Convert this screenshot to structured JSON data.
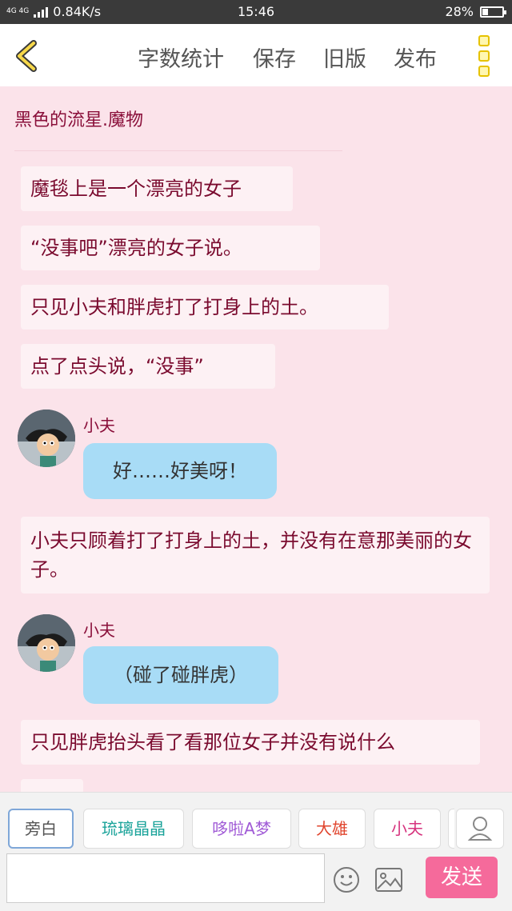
{
  "status_bar": {
    "network": "4G 4G",
    "speed": "0.84K/s",
    "time": "15:46",
    "battery": "28%",
    "battery_level": 0.28
  },
  "toolbar": {
    "back_icon": "chevron-left-icon",
    "word_count": "字数统计",
    "save": "保存",
    "old_version": "旧版",
    "publish": "发布",
    "more_icon": "more-vertical-icon"
  },
  "story": {
    "title": "黑色的流星.魔物",
    "messages": [
      {
        "type": "narration",
        "text": "魔毯上是一个漂亮的女子"
      },
      {
        "type": "narration",
        "text": "“没事吧”漂亮的女子说。"
      },
      {
        "type": "narration",
        "text": "只见小夫和胖虎打了打身上的土。"
      },
      {
        "type": "narration",
        "text": "点了点头说，“没事”"
      },
      {
        "type": "dialogue",
        "speaker": "小夫",
        "text": "好……好美呀！"
      },
      {
        "type": "narration",
        "text": "小夫只顾着打了打身上的土，并没有在意那美丽的女子。"
      },
      {
        "type": "dialogue",
        "speaker": "小夫",
        "text": "（碰了碰胖虎）"
      },
      {
        "type": "narration",
        "text": "只见胖虎抬头看了看那位女子并没有说什么"
      }
    ]
  },
  "characters": [
    {
      "label": "旁白",
      "color": "#555555"
    },
    {
      "label": "琉璃晶晶",
      "color": "#1aa39a"
    },
    {
      "label": "哆啦A梦",
      "color": "#a05ad6"
    },
    {
      "label": "大雄",
      "color": "#e0452e"
    },
    {
      "label": "小夫",
      "color": "#d6337e"
    }
  ],
  "composer": {
    "send_label": "发送",
    "emoji_icon": "smiley-icon",
    "image_icon": "image-icon",
    "user_icon": "user-icon"
  }
}
